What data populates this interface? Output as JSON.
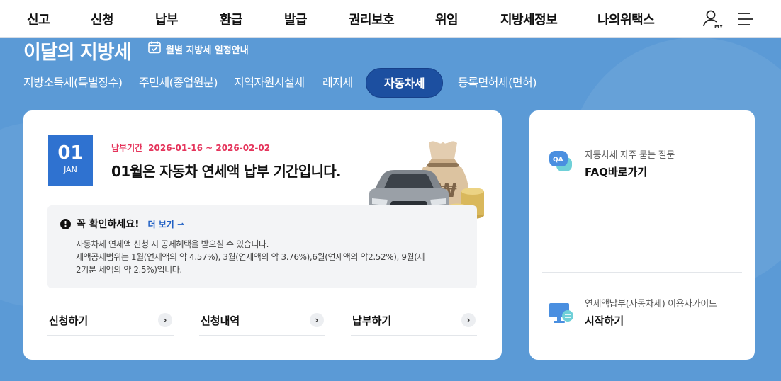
{
  "nav": {
    "items": [
      "신고",
      "신청",
      "납부",
      "환급",
      "발급",
      "권리보호",
      "위임",
      "지방세정보",
      "나의위택스"
    ],
    "my_label": "MY"
  },
  "header": {
    "title": "이달의 지방세",
    "schedule_link": "월별 지방세 일정안내"
  },
  "tabs": [
    {
      "label": "지방소득세(특별징수)",
      "active": false
    },
    {
      "label": "주민세(종업원분)",
      "active": false
    },
    {
      "label": "지역자원시설세",
      "active": false
    },
    {
      "label": "레저세",
      "active": false
    },
    {
      "label": "자동차세",
      "active": true
    },
    {
      "label": "등록면허세(면허)",
      "active": false
    }
  ],
  "main": {
    "date_day": "01",
    "date_month": "JAN",
    "period_label": "납부기간",
    "period_dates": "2026-01-16 ~ 2026-02-02",
    "headline": "01월은 자동차 연세액 납부 기간입니다.",
    "notice": {
      "icon_text": "!",
      "title": "꼭 확인하세요!",
      "more": "더 보기",
      "lines": [
        "자동차세 연세액 신청 시 공제혜택을 받으실 수 있습니다.",
        "세액공제범위는 1월(연세액의 약 4.57%), 3월(연세액의 약 3.76%),6월(연세액의 약2.52%), 9월(제",
        "2기분 세액의 약 2.5%)입니다."
      ]
    },
    "actions": [
      "신청하기",
      "신청내역",
      "납부하기"
    ],
    "action_arrow": "›"
  },
  "side": {
    "faq_sub": "자동차세 자주 묻는 질문",
    "faq_main": "FAQ바로가기",
    "faq_icon_text": "QA",
    "guide_sub": "연세액납부(자동차세) 이용자가이드",
    "guide_main": "시작하기"
  },
  "colors": {
    "background": "#5b9ad6",
    "active_tab": "#1c4fa0",
    "date_badge": "#2f72d0",
    "period": "#e5345b",
    "link": "#1f5fc4"
  }
}
